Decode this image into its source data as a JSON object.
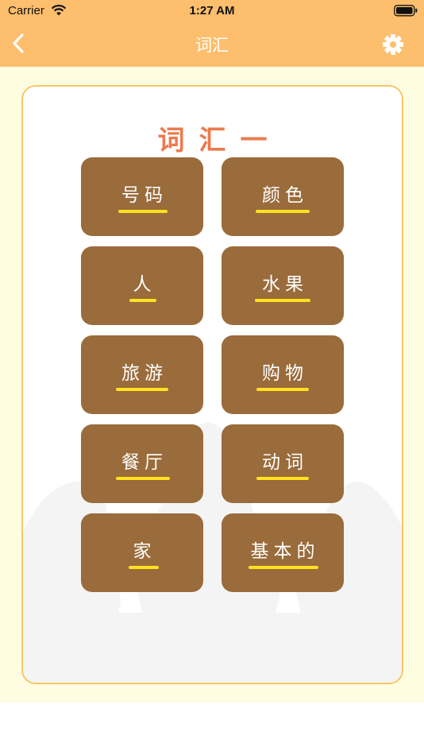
{
  "status_bar": {
    "carrier": "Carrier",
    "time": "1:27 AM"
  },
  "nav": {
    "title": "词汇",
    "back_icon": "chevron-left-icon",
    "settings_icon": "gear-icon"
  },
  "colors": {
    "header": "#fdbe6d",
    "background": "#fffde1",
    "card_border": "#f9c765",
    "tile": "#9a6b3b",
    "title": "#ec7a4c",
    "underline": "#ffe11f"
  },
  "section": {
    "title": "词汇一"
  },
  "tiles": [
    {
      "label": "号码"
    },
    {
      "label": "颜色"
    },
    {
      "label": "人"
    },
    {
      "label": "水果"
    },
    {
      "label": "旅游"
    },
    {
      "label": "购物"
    },
    {
      "label": "餐厅"
    },
    {
      "label": "动词"
    },
    {
      "label": "家"
    },
    {
      "label": "基本的"
    }
  ]
}
